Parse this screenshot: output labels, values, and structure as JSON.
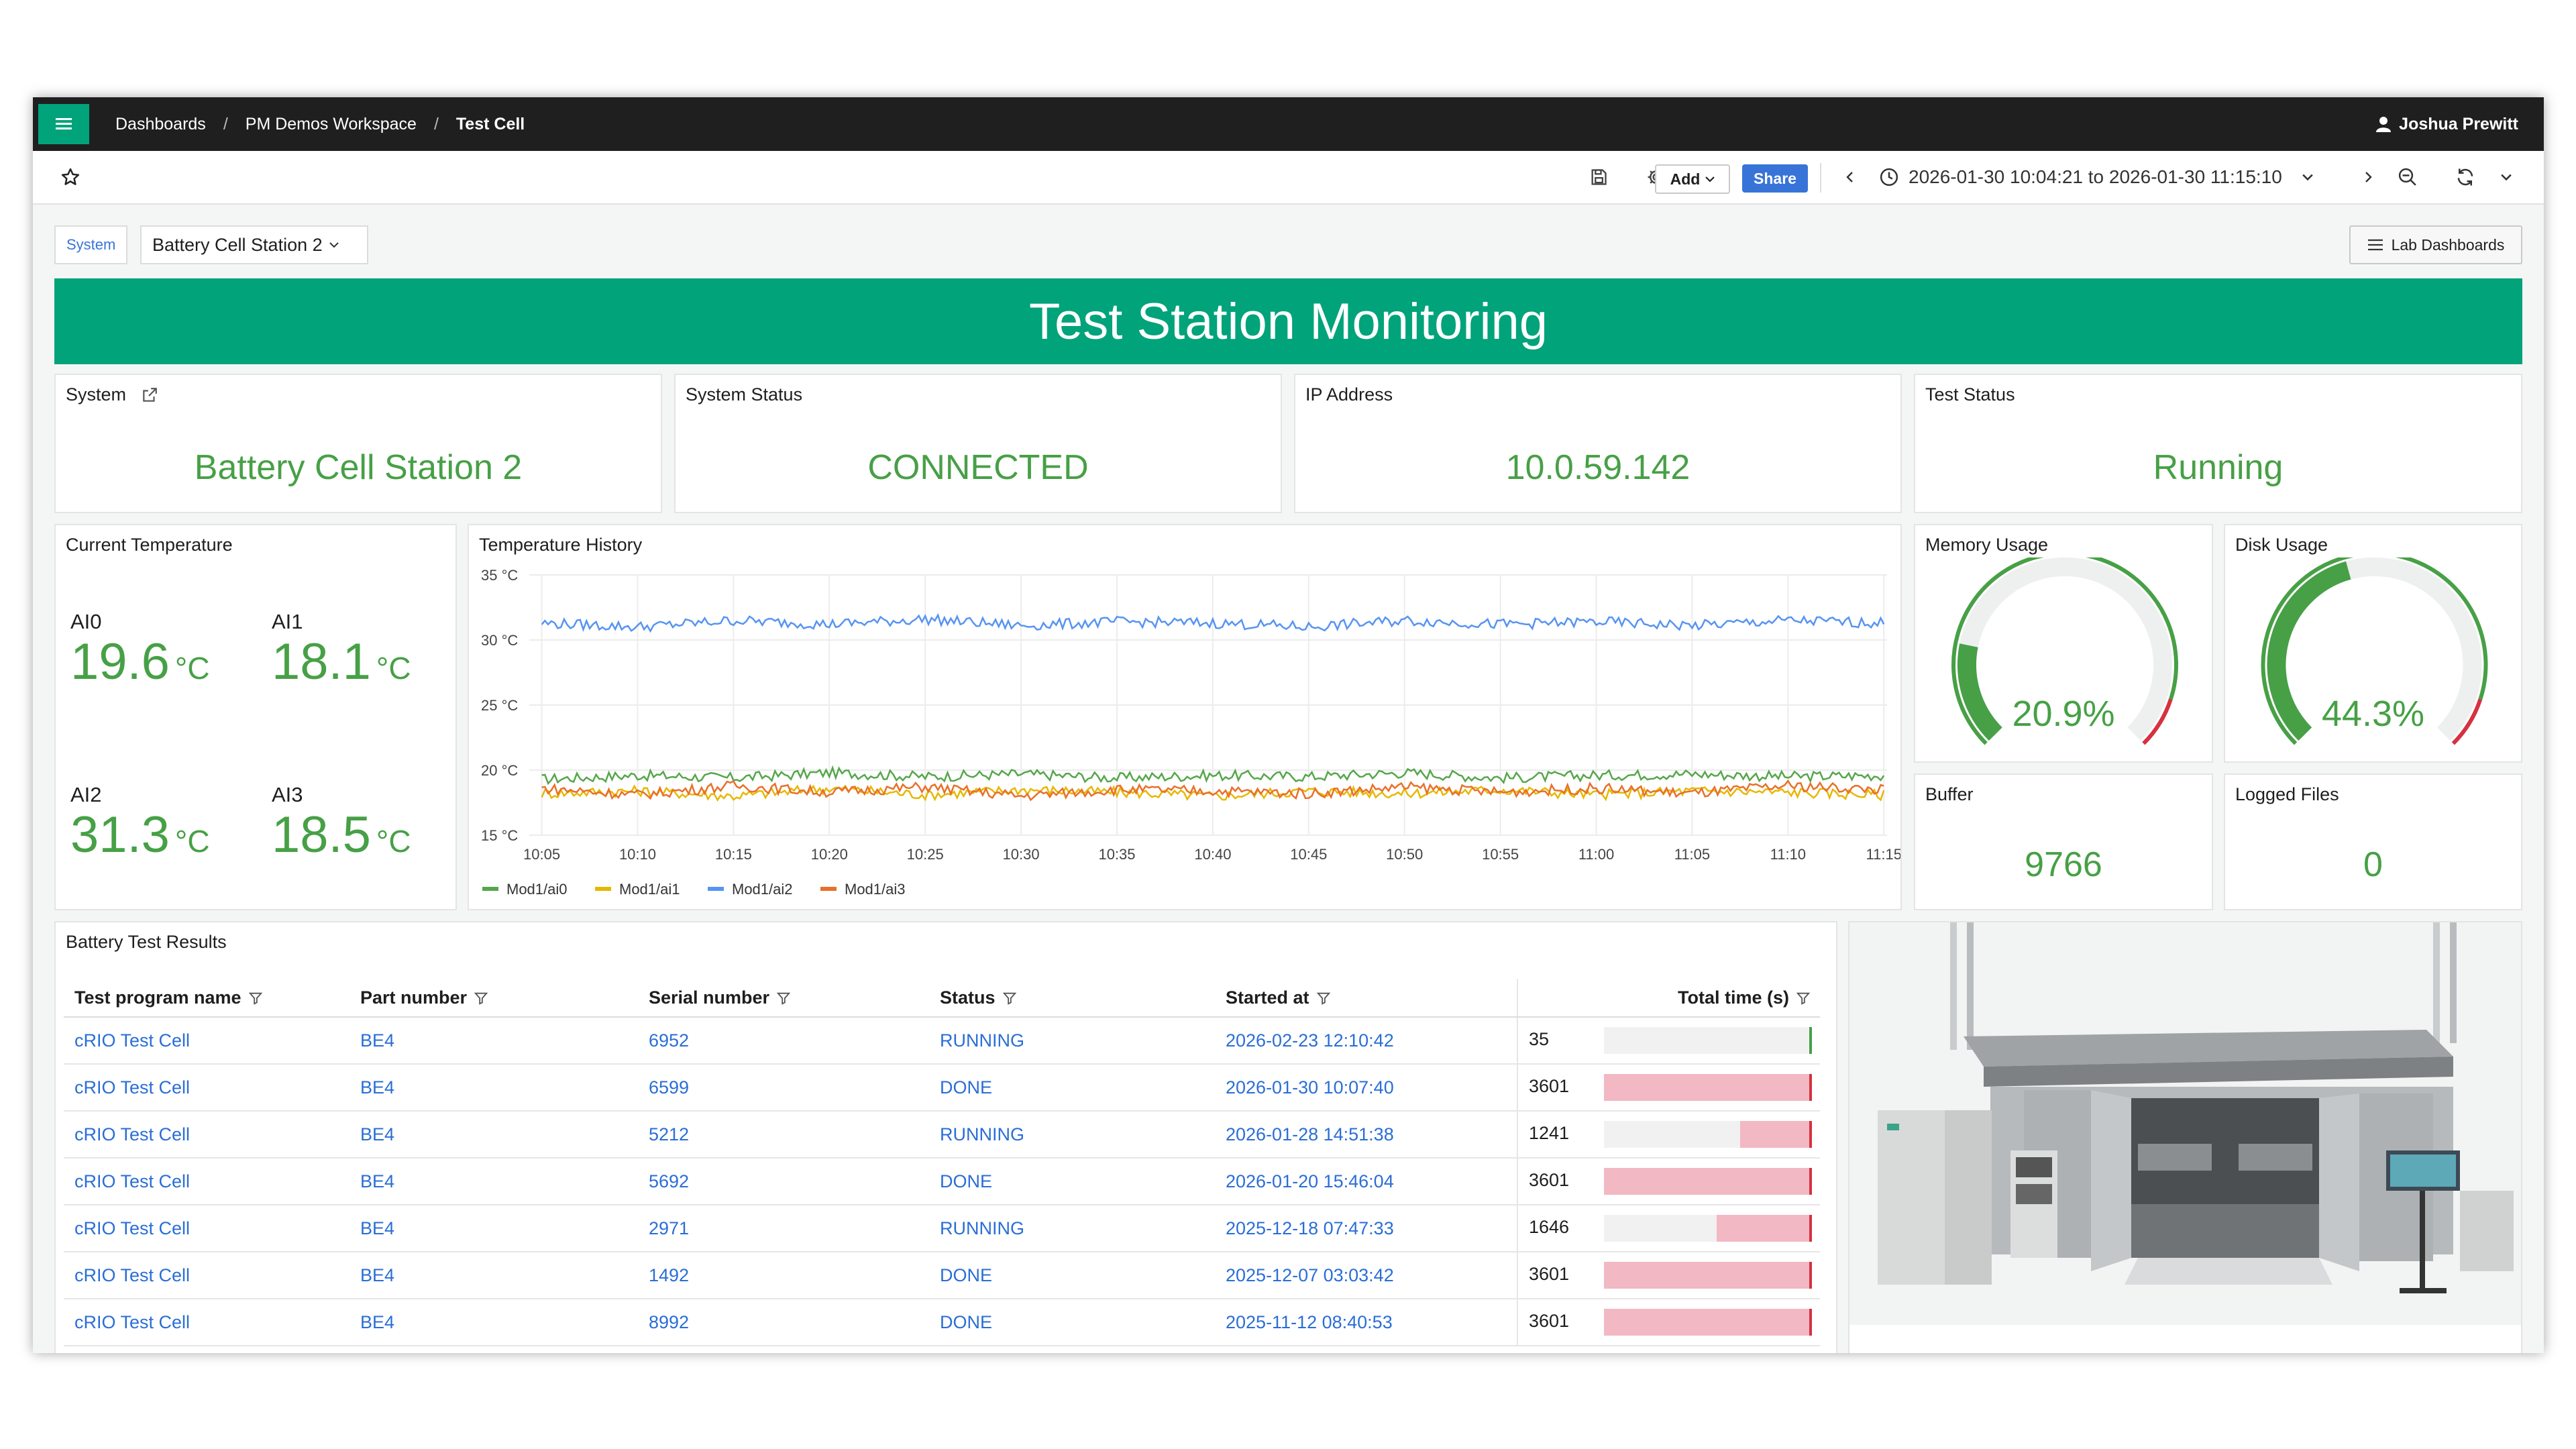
{
  "breadcrumb": [
    "Dashboards",
    "PM Demos Workspace",
    "Test Cell"
  ],
  "user": "Joshua Prewitt",
  "toolbar": {
    "add_label": "Add",
    "share_label": "Share",
    "time_range": "2026-01-30 10:04:21 to 2026-01-30 11:15:10"
  },
  "variables": {
    "label": "System",
    "selected": "Battery Cell Station 2",
    "lab_dashboards_label": "Lab Dashboards"
  },
  "banner_title": "Test Station Monitoring",
  "stats": {
    "system": {
      "title": "System",
      "value": "Battery Cell Station 2"
    },
    "system_status": {
      "title": "System Status",
      "value": "CONNECTED"
    },
    "ip": {
      "title": "IP Address",
      "value": "10.0.59.142"
    },
    "test_status": {
      "title": "Test Status",
      "value": "Running"
    }
  },
  "current_temperature": {
    "title": "Current Temperature",
    "unit": "°C",
    "channels": [
      {
        "name": "AI0",
        "value": "19.6"
      },
      {
        "name": "AI1",
        "value": "18.1"
      },
      {
        "name": "AI2",
        "value": "31.3"
      },
      {
        "name": "AI3",
        "value": "18.5"
      }
    ]
  },
  "temperature_history": {
    "title": "Temperature History"
  },
  "chart_data": {
    "type": "line",
    "title": "Temperature History",
    "xlabel": "",
    "ylabel": "",
    "x_ticks": [
      "10:05",
      "10:10",
      "10:15",
      "10:20",
      "10:25",
      "10:30",
      "10:35",
      "10:40",
      "10:45",
      "10:50",
      "10:55",
      "11:00",
      "11:05",
      "11:10",
      "11:15"
    ],
    "y_ticks": [
      "15 °C",
      "20 °C",
      "25 °C",
      "30 °C",
      "35 °C"
    ],
    "ylim": [
      15,
      35
    ],
    "xlim": [
      "10:04:21",
      "11:15:10"
    ],
    "grid": true,
    "legend_position": "bottom-left",
    "x": [
      "10:05",
      "10:10",
      "10:15",
      "10:20",
      "10:25",
      "10:30",
      "10:35",
      "10:40",
      "10:45",
      "10:50",
      "10:55",
      "11:00",
      "11:05",
      "11:10",
      "11:15"
    ],
    "series": [
      {
        "name": "Mod1/ai0",
        "color": "#56a64b",
        "values": [
          19.3,
          19.6,
          19.4,
          19.8,
          19.5,
          19.7,
          19.4,
          19.6,
          19.5,
          19.8,
          19.4,
          19.6,
          19.7,
          19.5,
          19.6
        ]
      },
      {
        "name": "Mod1/ai1",
        "color": "#e6b800",
        "values": [
          18.2,
          18.4,
          18.0,
          18.6,
          18.1,
          18.5,
          18.3,
          18.0,
          18.4,
          18.2,
          18.5,
          18.1,
          18.4,
          18.3,
          18.1
        ]
      },
      {
        "name": "Mod1/ai2",
        "color": "#5794f2",
        "values": [
          31.3,
          31.0,
          31.5,
          31.2,
          31.6,
          31.1,
          31.4,
          31.3,
          31.0,
          31.5,
          31.2,
          31.4,
          31.1,
          31.5,
          31.3
        ]
      },
      {
        "name": "Mod1/ai3",
        "color": "#e8702a",
        "values": [
          18.6,
          18.1,
          18.8,
          18.3,
          18.7,
          18.0,
          18.5,
          18.4,
          18.2,
          18.7,
          18.3,
          18.6,
          18.2,
          18.8,
          18.5
        ]
      }
    ]
  },
  "memory_usage": {
    "title": "Memory Usage",
    "value": "20.9%",
    "fraction": 0.209
  },
  "disk_usage": {
    "title": "Disk Usage",
    "value": "44.3%",
    "fraction": 0.443
  },
  "buffer": {
    "title": "Buffer",
    "value": "9766"
  },
  "logged_files": {
    "title": "Logged Files",
    "value": "0"
  },
  "results": {
    "title": "Battery Test Results",
    "columns": [
      "Test program name",
      "Part number",
      "Serial number",
      "Status",
      "Started at",
      "Total time (s)"
    ],
    "rows": [
      {
        "program": "cRIO Test Cell",
        "part": "BE4",
        "serial": "6952",
        "status": "RUNNING",
        "started": "2026-02-23 12:10:42",
        "total": "35",
        "fraction": 0.01
      },
      {
        "program": "cRIO Test Cell",
        "part": "BE4",
        "serial": "6599",
        "status": "DONE",
        "started": "2026-01-30 10:07:40",
        "total": "3601",
        "fraction": 1.0
      },
      {
        "program": "cRIO Test Cell",
        "part": "BE4",
        "serial": "5212",
        "status": "RUNNING",
        "started": "2026-01-28 14:51:38",
        "total": "1241",
        "fraction": 0.345
      },
      {
        "program": "cRIO Test Cell",
        "part": "BE4",
        "serial": "5692",
        "status": "DONE",
        "started": "2026-01-20 15:46:04",
        "total": "3601",
        "fraction": 1.0
      },
      {
        "program": "cRIO Test Cell",
        "part": "BE4",
        "serial": "2971",
        "status": "RUNNING",
        "started": "2025-12-18 07:47:33",
        "total": "1646",
        "fraction": 0.457
      },
      {
        "program": "cRIO Test Cell",
        "part": "BE4",
        "serial": "1492",
        "status": "DONE",
        "started": "2025-12-07 03:03:42",
        "total": "3601",
        "fraction": 1.0
      },
      {
        "program": "cRIO Test Cell",
        "part": "BE4",
        "serial": "8992",
        "status": "DONE",
        "started": "2025-11-12 08:40:53",
        "total": "3601",
        "fraction": 1.0
      }
    ]
  },
  "colors": {
    "accent": "#00a37a",
    "stat_green": "#47a046",
    "link_blue": "#2a6ed6",
    "gauge_red": "#d6313f"
  }
}
